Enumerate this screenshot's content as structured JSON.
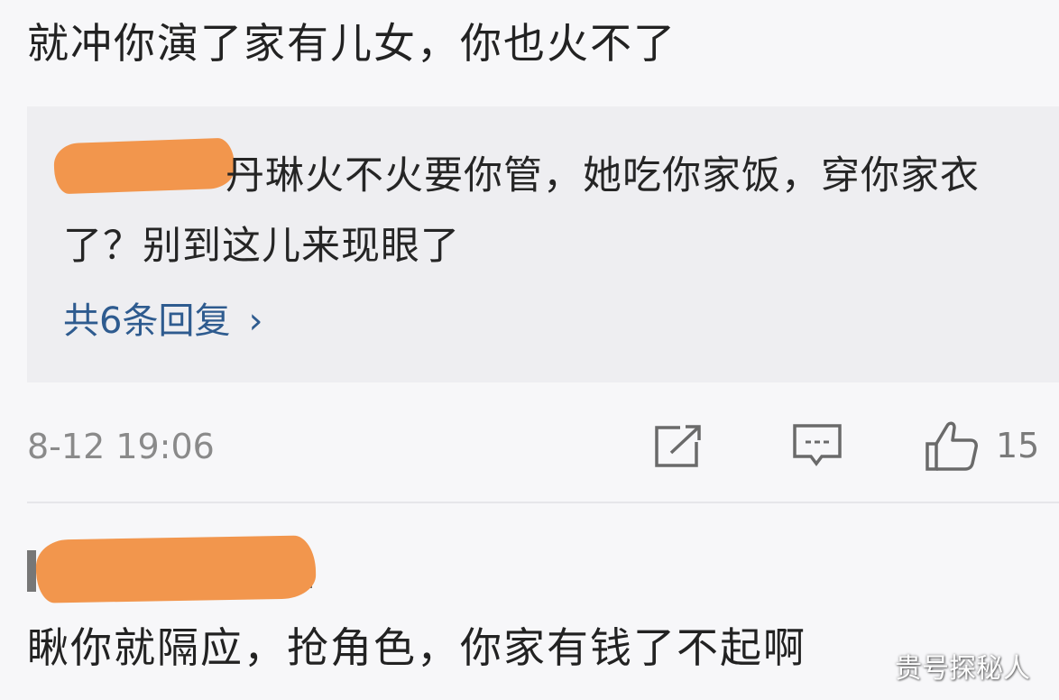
{
  "comment1": {
    "text": "就冲你演了家有儿女，你也火不了"
  },
  "reply": {
    "text": "丹琳火不火要你管，她吃你家饭，穿你家衣了？别到这儿来现眼了",
    "more_replies_label": "共6条回复",
    "more_replies_chevron": "›"
  },
  "meta": {
    "timestamp": "8-12 19:06",
    "like_count": "15"
  },
  "icons": {
    "share": "share-icon",
    "comment": "comment-icon",
    "like": "thumbs-up-icon",
    "chevron": "chevron-right-icon"
  },
  "comment2": {
    "text": "瞅你就隔应，抢角色，你家有钱了不起啊"
  },
  "watermark": {
    "text": "贵号探秘人"
  },
  "colors": {
    "background": "#f7f7f9",
    "reply_box": "#eeeef1",
    "link": "#2e5b8f",
    "meta": "#8a8a8a",
    "redaction": "#f2964d"
  }
}
